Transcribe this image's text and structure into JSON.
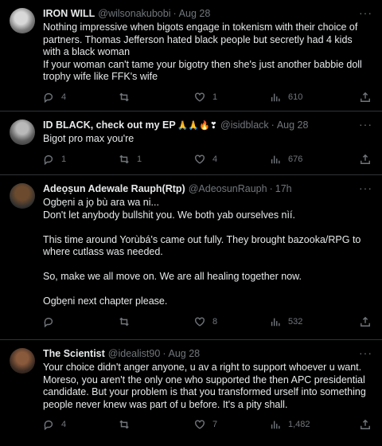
{
  "tweets": [
    {
      "name": "IRON WILL",
      "handle": "@wilsonakubobi",
      "time": "Aug 28",
      "lines": [
        "Nothing impressive when bigots engage in tokenism with their choice of",
        "partners. Thomas Jefferson hated black people but secretly had 4 kids",
        "with a black woman",
        "If your woman can't tame your bigotry then she's just another babbie doll",
        "trophy wife like FFK's wife"
      ],
      "replies": "4",
      "retweets": "",
      "likes": "1",
      "views": "610"
    },
    {
      "name": "ID BLACK, check out my EP",
      "name_emoji": "🙏🙏🔥❣",
      "handle": "@isidblack",
      "time": "Aug 28",
      "lines": [
        "Bigot pro max you're"
      ],
      "replies": "1",
      "retweets": "1",
      "likes": "4",
      "views": "676"
    },
    {
      "name": "Adeọṣun Adewale Rauph(Rtp)",
      "handle": "@AdeosunRauph",
      "time": "17h",
      "lines": [
        "Ogbẹni a jọ bù ara wa ni...",
        "Don't let anybody bullshit you. We both yab ourselves nìí.",
        "",
        "This time around Yorùbá's came out fully. They brought bazooka/RPG to",
        "where cutlass was needed.",
        "",
        "So, make we all move on. We are all healing together now.",
        "",
        "Ogbẹni next chapter please."
      ],
      "replies": "",
      "retweets": "",
      "likes": "8",
      "views": "532"
    },
    {
      "name": "The Scientist",
      "handle": "@idealist90",
      "time": "Aug 28",
      "lines": [
        "Your choice didn't anger anyone, u av a right to support whoever u want.",
        "Moreso, you aren't the only one who supported the then APC presidential",
        "candidate.  But your problem is that you transformed urself into something",
        "people never knew was part of u before. It's a pity shall."
      ],
      "replies": "4",
      "retweets": "",
      "likes": "7",
      "views": "1,482"
    }
  ],
  "more_glyph": "···",
  "separator": "·"
}
